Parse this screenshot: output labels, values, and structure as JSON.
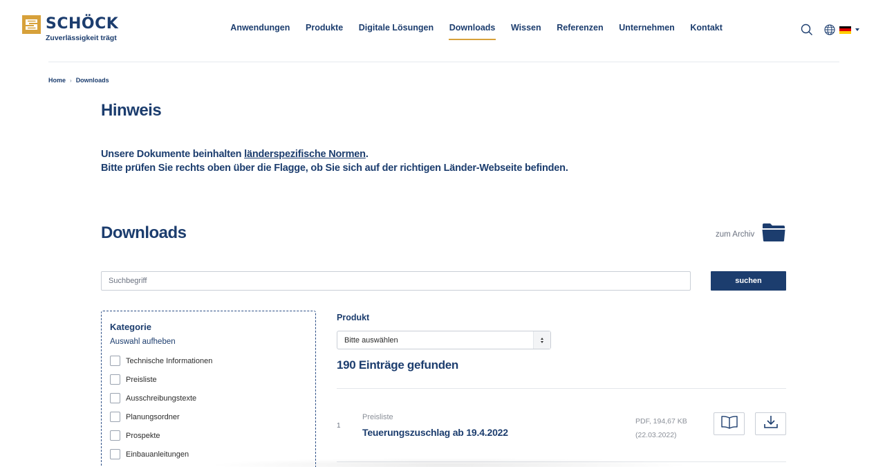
{
  "brand": {
    "name": "SCHÖCK",
    "claim": "Zuverlässigkeit trägt",
    "logo_color": "#d7a13a"
  },
  "nav": {
    "items": [
      {
        "label": "Anwendungen",
        "active": false
      },
      {
        "label": "Produkte",
        "active": false
      },
      {
        "label": "Digitale Lösungen",
        "active": false
      },
      {
        "label": "Downloads",
        "active": true
      },
      {
        "label": "Wissen",
        "active": false
      },
      {
        "label": "Referenzen",
        "active": false
      },
      {
        "label": "Unternehmen",
        "active": false
      },
      {
        "label": "Kontakt",
        "active": false
      }
    ],
    "accent": "#d7a13a",
    "icons": [
      "search-icon",
      "globe-icon",
      "flag-de-icon",
      "caret-down-icon"
    ]
  },
  "breadcrumb": {
    "items": [
      "Home",
      "Downloads"
    ]
  },
  "notice": {
    "title": "Hinweis",
    "line1_before": "Unsere Dokumente beinhalten ",
    "line1_link": "länderspezifische Normen",
    "line1_after": ".",
    "line2": "Bitte prüfen Sie rechts oben über die Flagge, ob Sie sich auf der richtigen Länder-Webseite befinden."
  },
  "downloads": {
    "title": "Downloads",
    "archive_label": "zum Archiv",
    "search_placeholder": "Suchbegriff",
    "search_button": "suchen"
  },
  "filter": {
    "title": "Kategorie",
    "reset": "Auswahl aufheben",
    "categories": [
      "Technische Informationen",
      "Preisliste",
      "Ausschreibungstexte",
      "Planungsordner",
      "Prospekte",
      "Einbauanleitungen"
    ]
  },
  "product": {
    "label": "Produkt",
    "selected": "Bitte auswählen"
  },
  "results": {
    "count_label": "190 Einträge gefunden",
    "items": [
      {
        "number": "1",
        "category": "Preisliste",
        "title": "Teuerungszuschlag ab 19.4.2022",
        "meta": "PDF, 194,67 KB",
        "date": "(22.03.2022)"
      }
    ]
  },
  "colors": {
    "primary": "#1c3d6e",
    "accent": "#d7a13a",
    "muted": "#8a8f98"
  }
}
